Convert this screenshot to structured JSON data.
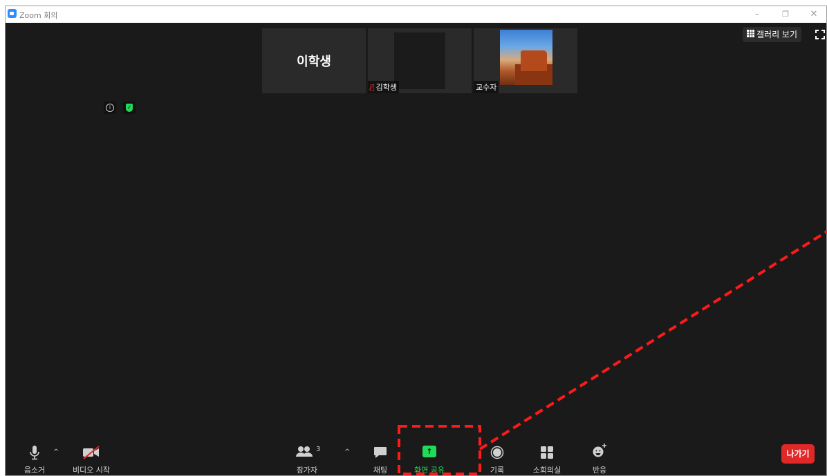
{
  "window": {
    "title": "Zoom 회의"
  },
  "window_controls": {
    "minimize": "–",
    "restore": "❐",
    "close": "✕"
  },
  "participants_strip": {
    "tiles": [
      {
        "name": "이학생",
        "video": "off"
      },
      {
        "name": "김학생",
        "video": "on-black",
        "muted": true
      },
      {
        "name": "교수자",
        "video": "photo"
      }
    ]
  },
  "view": {
    "gallery_label": "갤러리 보기"
  },
  "toolbar": {
    "mute_label": "음소거",
    "video_label": "비디오 시작",
    "participants_label": "참가자",
    "participants_count": "3",
    "chat_label": "채팅",
    "share_label": "화면 공유",
    "share_icon": "↑",
    "record_label": "기록",
    "breakout_label": "소회의실",
    "reactions_label": "반응",
    "leave_label": "나가기"
  },
  "annotation": {
    "highlight_color": "#ff1a1a",
    "target": "화면 공유"
  },
  "colors": {
    "background": "#1a1a1a",
    "tile": "#2a2a2a",
    "accent_green": "#23d959",
    "leave_red": "#e02828",
    "brand_blue": "#2d8cff"
  }
}
